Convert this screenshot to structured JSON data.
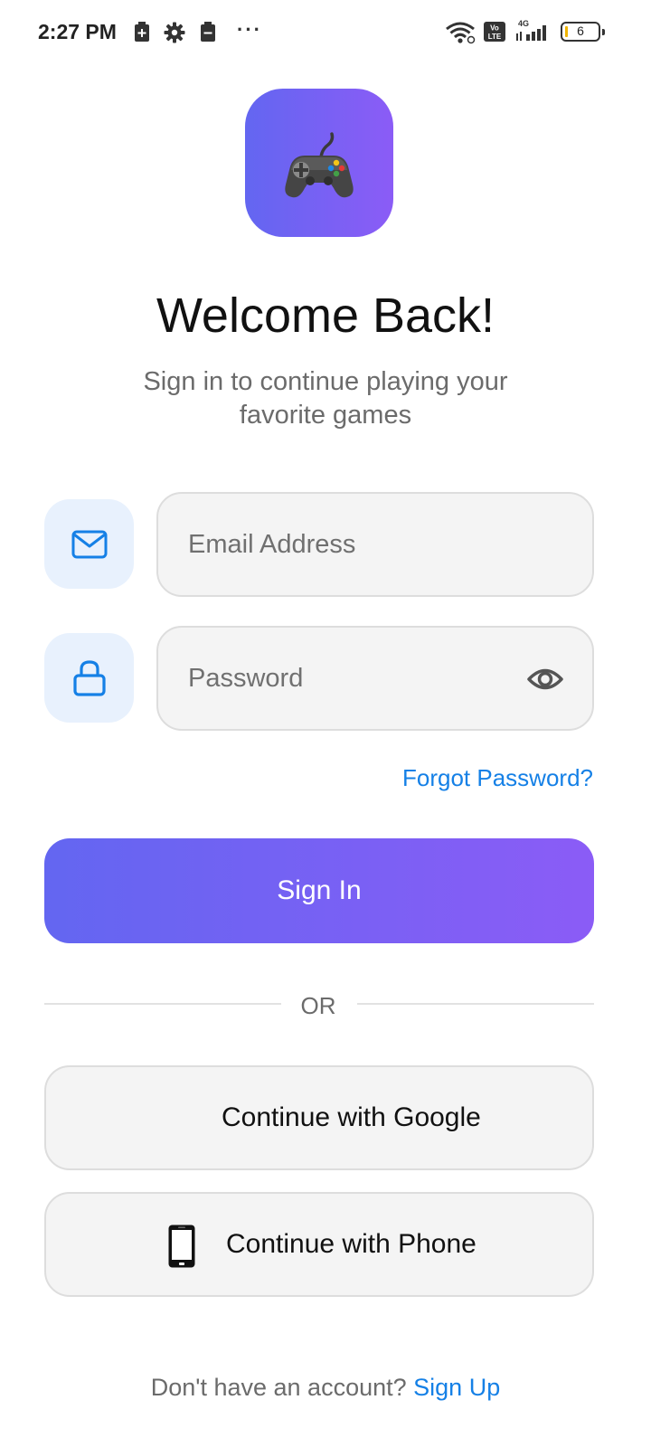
{
  "status_bar": {
    "time": "2:27 PM",
    "left_icons": [
      "battery-saver-icon",
      "gear-icon",
      "battery-saver-icon",
      "more-dots-icon"
    ],
    "right_icons": [
      "wifi-icon",
      "volte-icon",
      "signal-4g-icon",
      "battery-icon"
    ],
    "battery_level": "6",
    "more": "···"
  },
  "app": {
    "logo_icon": "game-controller-icon",
    "logo_gradient": [
      "#6366f1",
      "#8b5cf6"
    ],
    "title": "Welcome Back!",
    "subtitle": "Sign in to continue playing your favorite games"
  },
  "form": {
    "email": {
      "icon": "mail-icon",
      "placeholder": "Email Address",
      "value": ""
    },
    "password": {
      "icon": "lock-icon",
      "placeholder": "Password",
      "value": "",
      "toggle_icon": "eye-icon"
    },
    "forgot_label": "Forgot Password?",
    "signin_label": "Sign In"
  },
  "divider": {
    "label": "OR"
  },
  "social": {
    "google_label": "Continue with Google",
    "phone_label": "Continue with Phone",
    "phone_icon": "smartphone-icon"
  },
  "footer": {
    "prompt": "Don't have an account?",
    "signup_label": "Sign Up"
  },
  "colors": {
    "accent_blue": "#1580e6",
    "icon_box_bg": "#e8f1fd",
    "field_bg": "#f4f4f4"
  }
}
